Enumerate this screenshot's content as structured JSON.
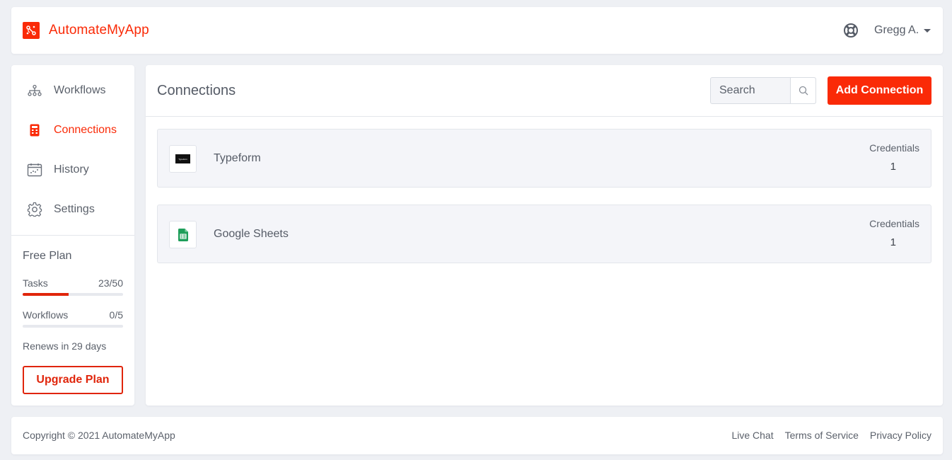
{
  "header": {
    "app_name": "AutomateMyApp",
    "logo_icon": "logo-icon",
    "help_icon": "lifebuoy-icon",
    "user_name": "Gregg A."
  },
  "sidebar": {
    "items": [
      {
        "label": "Workflows",
        "icon": "sitemap-icon",
        "active": false
      },
      {
        "label": "Connections",
        "icon": "calculator-icon",
        "active": true
      },
      {
        "label": "History",
        "icon": "calendar-icon",
        "active": false
      },
      {
        "label": "Settings",
        "icon": "gear-icon",
        "active": false
      }
    ],
    "plan": {
      "title": "Free Plan",
      "tasks_label": "Tasks",
      "tasks_value": "23/50",
      "tasks_fraction": 0.46,
      "workflows_label": "Workflows",
      "workflows_value": "0/5",
      "workflows_fraction": 0,
      "renews_text": "Renews in 29 days",
      "upgrade_label": "Upgrade Plan"
    }
  },
  "main": {
    "title": "Connections",
    "search": {
      "placeholder": "Search",
      "icon": "search-icon"
    },
    "add_button_label": "Add Connection",
    "connections": [
      {
        "name": "Typeform",
        "icon": "typeform-icon",
        "icon_text": "Typeform",
        "credentials_label": "Credentials",
        "credentials_count": "1"
      },
      {
        "name": "Google Sheets",
        "icon": "google-sheets-icon",
        "credentials_label": "Credentials",
        "credentials_count": "1"
      }
    ]
  },
  "footer": {
    "copyright": "Copyright © 2021 AutomateMyApp",
    "links": [
      "Live Chat",
      "Terms of Service",
      "Privacy Policy"
    ]
  },
  "colors": {
    "accent": "#fa2a07",
    "background": "#eef0f4",
    "row_background": "#f4f5f9",
    "sheets_green": "#1e9e5a"
  }
}
